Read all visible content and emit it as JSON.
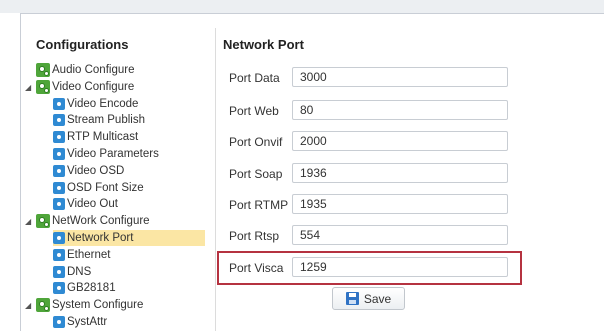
{
  "sidebar": {
    "title": "Configurations",
    "items": [
      {
        "label": "Audio Configure",
        "level": 0,
        "type": "parent",
        "arrow": ""
      },
      {
        "label": "Video Configure",
        "level": 0,
        "type": "parent",
        "arrow": "◢"
      },
      {
        "label": "Video Encode",
        "level": 1,
        "type": "child"
      },
      {
        "label": "Stream Publish",
        "level": 1,
        "type": "child"
      },
      {
        "label": "RTP Multicast",
        "level": 1,
        "type": "child"
      },
      {
        "label": "Video Parameters",
        "level": 1,
        "type": "child"
      },
      {
        "label": "Video OSD",
        "level": 1,
        "type": "child"
      },
      {
        "label": "OSD Font Size",
        "level": 1,
        "type": "child"
      },
      {
        "label": "Video Out",
        "level": 1,
        "type": "child"
      },
      {
        "label": "NetWork Configure",
        "level": 0,
        "type": "parent",
        "arrow": "◢"
      },
      {
        "label": "Network Port",
        "level": 1,
        "type": "child",
        "selected": true
      },
      {
        "label": "Ethernet",
        "level": 1,
        "type": "child"
      },
      {
        "label": "DNS",
        "level": 1,
        "type": "child"
      },
      {
        "label": "GB28181",
        "level": 1,
        "type": "child"
      },
      {
        "label": "System Configure",
        "level": 0,
        "type": "parent",
        "arrow": "◢"
      },
      {
        "label": "SystAttr",
        "level": 1,
        "type": "child"
      }
    ]
  },
  "main": {
    "title": "Network Port",
    "fields": [
      {
        "label": "Port Data",
        "value": "3000"
      },
      {
        "label": "Port Web",
        "value": "80"
      },
      {
        "label": "Port Onvif",
        "value": "2000"
      },
      {
        "label": "Port Soap",
        "value": "1936"
      },
      {
        "label": "Port RTMP",
        "value": "1935"
      },
      {
        "label": "Port Rtsp",
        "value": "554"
      },
      {
        "label": "Port Visca",
        "value": "1259"
      }
    ],
    "save_label": "Save"
  },
  "colors": {
    "selected_bg": "#fbe6a4",
    "highlight_border": "#b53240",
    "child_icon": "#2f8ad3",
    "parent_icon": "#4fa53a"
  }
}
